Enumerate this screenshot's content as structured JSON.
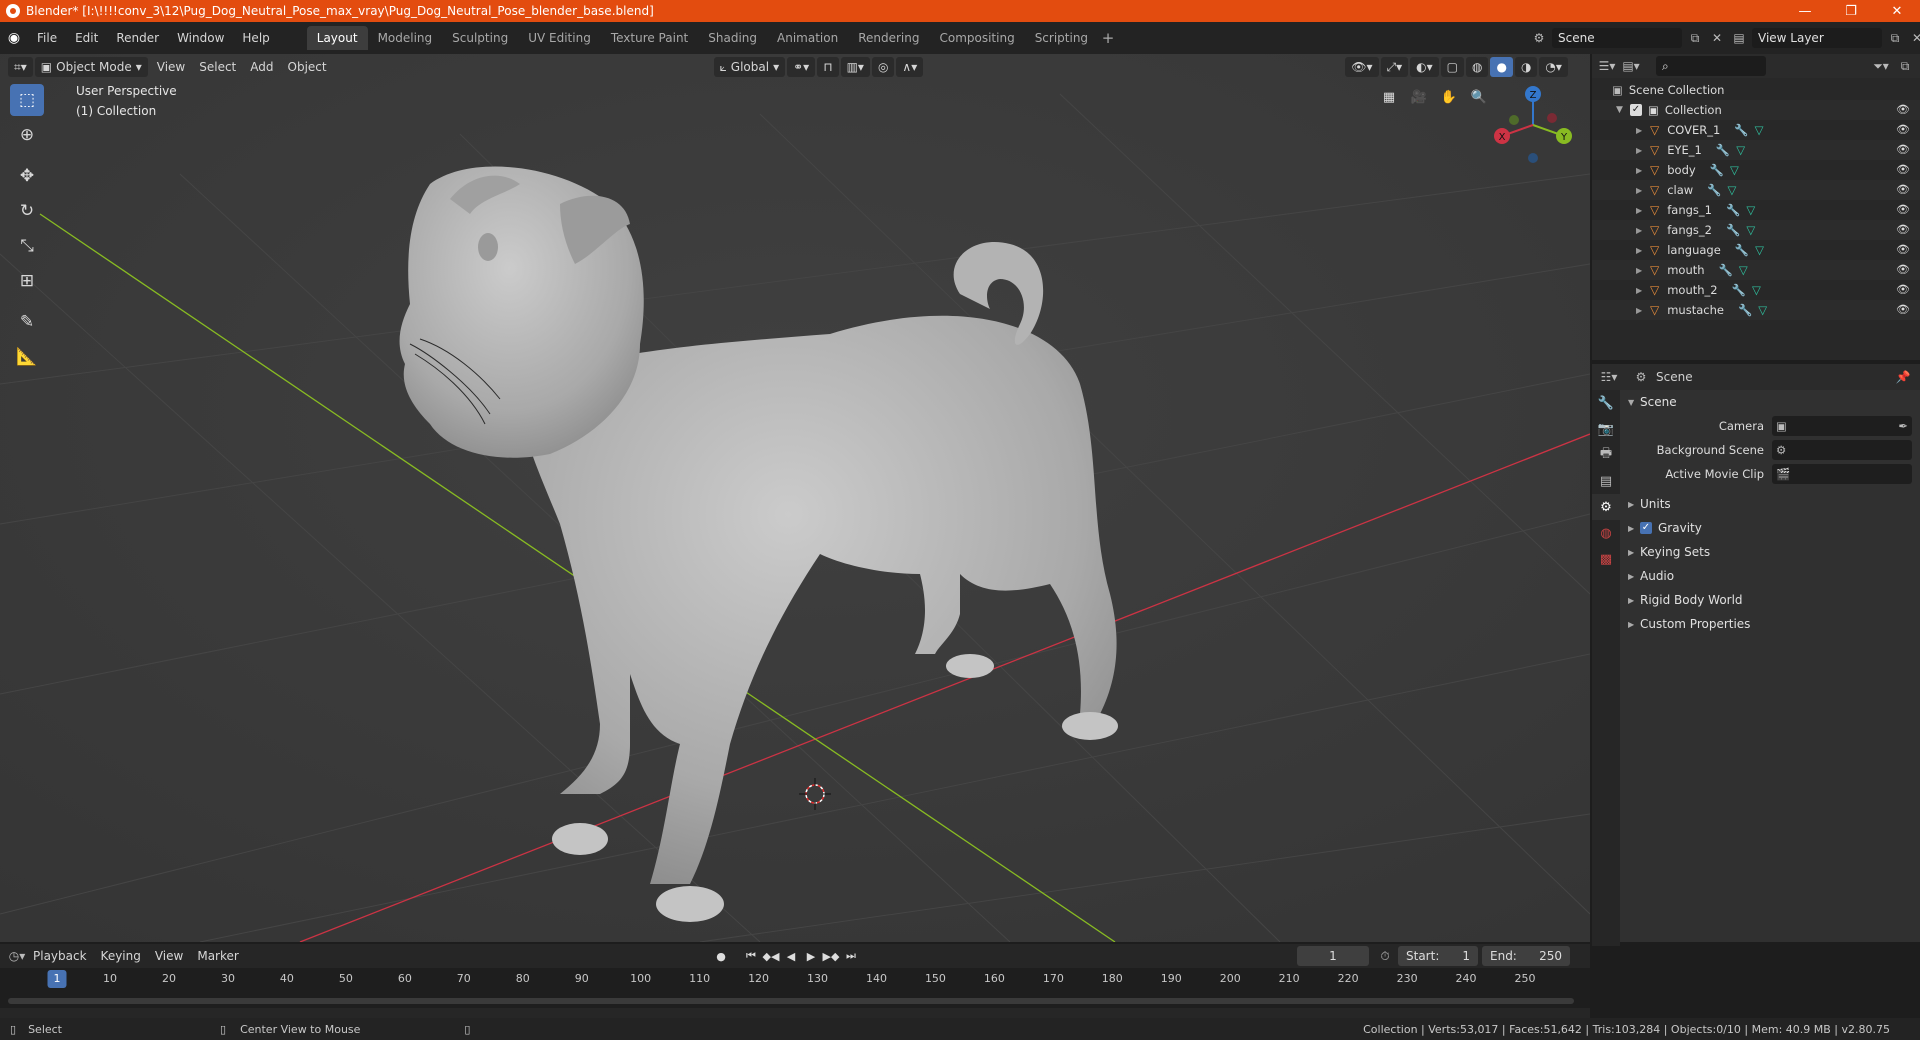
{
  "window": {
    "title": "Blender* [I:\\!!!!conv_3\\12\\Pug_Dog_Neutral_Pose_max_vray\\Pug_Dog_Neutral_Pose_blender_base.blend]",
    "minimize": "—",
    "restore": "❐",
    "close": "✕"
  },
  "menu": [
    "File",
    "Edit",
    "Render",
    "Window",
    "Help"
  ],
  "workspaces": [
    {
      "label": "Layout",
      "active": true
    },
    {
      "label": "Modeling"
    },
    {
      "label": "Sculpting"
    },
    {
      "label": "UV Editing"
    },
    {
      "label": "Texture Paint"
    },
    {
      "label": "Shading"
    },
    {
      "label": "Animation"
    },
    {
      "label": "Rendering"
    },
    {
      "label": "Compositing"
    },
    {
      "label": "Scripting"
    }
  ],
  "scene_selector": "Scene",
  "view_layer_selector": "View Layer",
  "viewport": {
    "mode": "Object Mode",
    "menus": [
      "View",
      "Select",
      "Add",
      "Object"
    ],
    "orientation": "Global",
    "perspective_label": "User Perspective",
    "collection_label": "(1) Collection",
    "axes": {
      "z": "Z",
      "y": "Y",
      "x": "X"
    }
  },
  "outliner": {
    "root": "Scene Collection",
    "collection": "Collection",
    "items": [
      "COVER_1",
      "EYE_1",
      "body",
      "claw",
      "fangs_1",
      "fangs_2",
      "language",
      "mouth",
      "mouth_2",
      "mustache"
    ]
  },
  "properties": {
    "header": "Scene",
    "panel": "Scene",
    "rows": [
      {
        "label": "Camera"
      },
      {
        "label": "Background Scene"
      },
      {
        "label": "Active Movie Clip"
      }
    ],
    "sections": [
      "Units",
      "Gravity",
      "Keying Sets",
      "Audio",
      "Rigid Body World",
      "Custom Properties"
    ]
  },
  "timeline": {
    "menus": [
      "Playback",
      "Keying",
      "View",
      "Marker"
    ],
    "current_frame": "1",
    "start_label": "Start:",
    "start": "1",
    "end_label": "End:",
    "end": "250",
    "ticks": [
      "1",
      "10",
      "20",
      "30",
      "40",
      "50",
      "60",
      "70",
      "80",
      "90",
      "100",
      "110",
      "120",
      "130",
      "140",
      "150",
      "160",
      "170",
      "180",
      "190",
      "200",
      "210",
      "220",
      "230",
      "240",
      "250"
    ]
  },
  "statusbar": {
    "select": "Select",
    "center_view": "Center View to Mouse",
    "stats": "Collection | Verts:53,017 | Faces:51,642 | Tris:103,284 | Objects:0/10 | Mem: 40.9 MB | v2.80.75"
  },
  "colors": {
    "titlebar": "#e34c0f",
    "accent": "#4772b3",
    "x_axis": "#cc3344",
    "y_axis": "#88bb22",
    "z_axis": "#3377cc",
    "object_icon": "#e38a3a",
    "mesh_icon": "#2fc2a0",
    "modifier_icon": "#6aa2ff"
  }
}
